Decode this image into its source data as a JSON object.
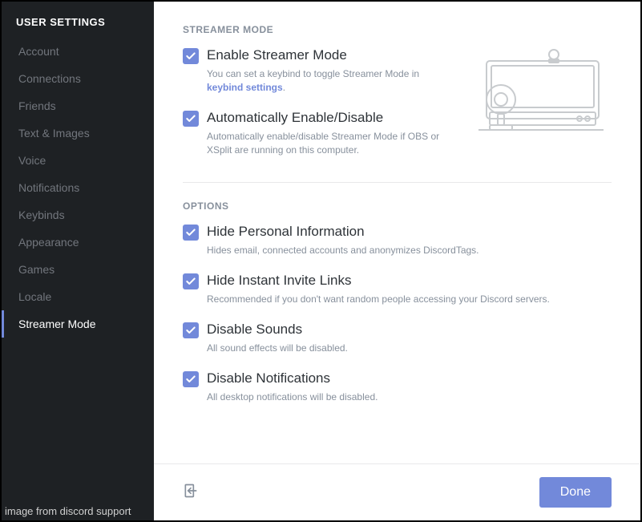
{
  "sidebar": {
    "title": "USER SETTINGS",
    "items": [
      {
        "label": "Account"
      },
      {
        "label": "Connections"
      },
      {
        "label": "Friends"
      },
      {
        "label": "Text & Images"
      },
      {
        "label": "Voice"
      },
      {
        "label": "Notifications"
      },
      {
        "label": "Keybinds"
      },
      {
        "label": "Appearance"
      },
      {
        "label": "Games"
      },
      {
        "label": "Locale"
      },
      {
        "label": "Streamer Mode"
      }
    ],
    "active_index": 10,
    "caption": "image from discord support"
  },
  "main": {
    "section_streamer": {
      "header": "STREAMER MODE",
      "opt_enable": {
        "title": "Enable Streamer Mode",
        "desc_prefix": "You can set a keybind to toggle Streamer Mode in ",
        "desc_link": "keybind settings",
        "desc_suffix": "."
      },
      "opt_auto": {
        "title": "Automatically Enable/Disable",
        "desc": "Automatically enable/disable Streamer Mode if OBS or XSplit are running on this computer."
      }
    },
    "section_options": {
      "header": "OPTIONS",
      "opt_personal": {
        "title": "Hide Personal Information",
        "desc": "Hides email, connected accounts and anonymizes DiscordTags."
      },
      "opt_invite": {
        "title": "Hide Instant Invite Links",
        "desc": "Recommended if you don't want random people accessing your Discord servers."
      },
      "opt_sounds": {
        "title": "Disable Sounds",
        "desc": "All sound effects will be disabled."
      },
      "opt_notifs": {
        "title": "Disable Notifications",
        "desc": "All desktop notifications will be disabled."
      }
    }
  },
  "footer": {
    "done_label": "Done"
  }
}
